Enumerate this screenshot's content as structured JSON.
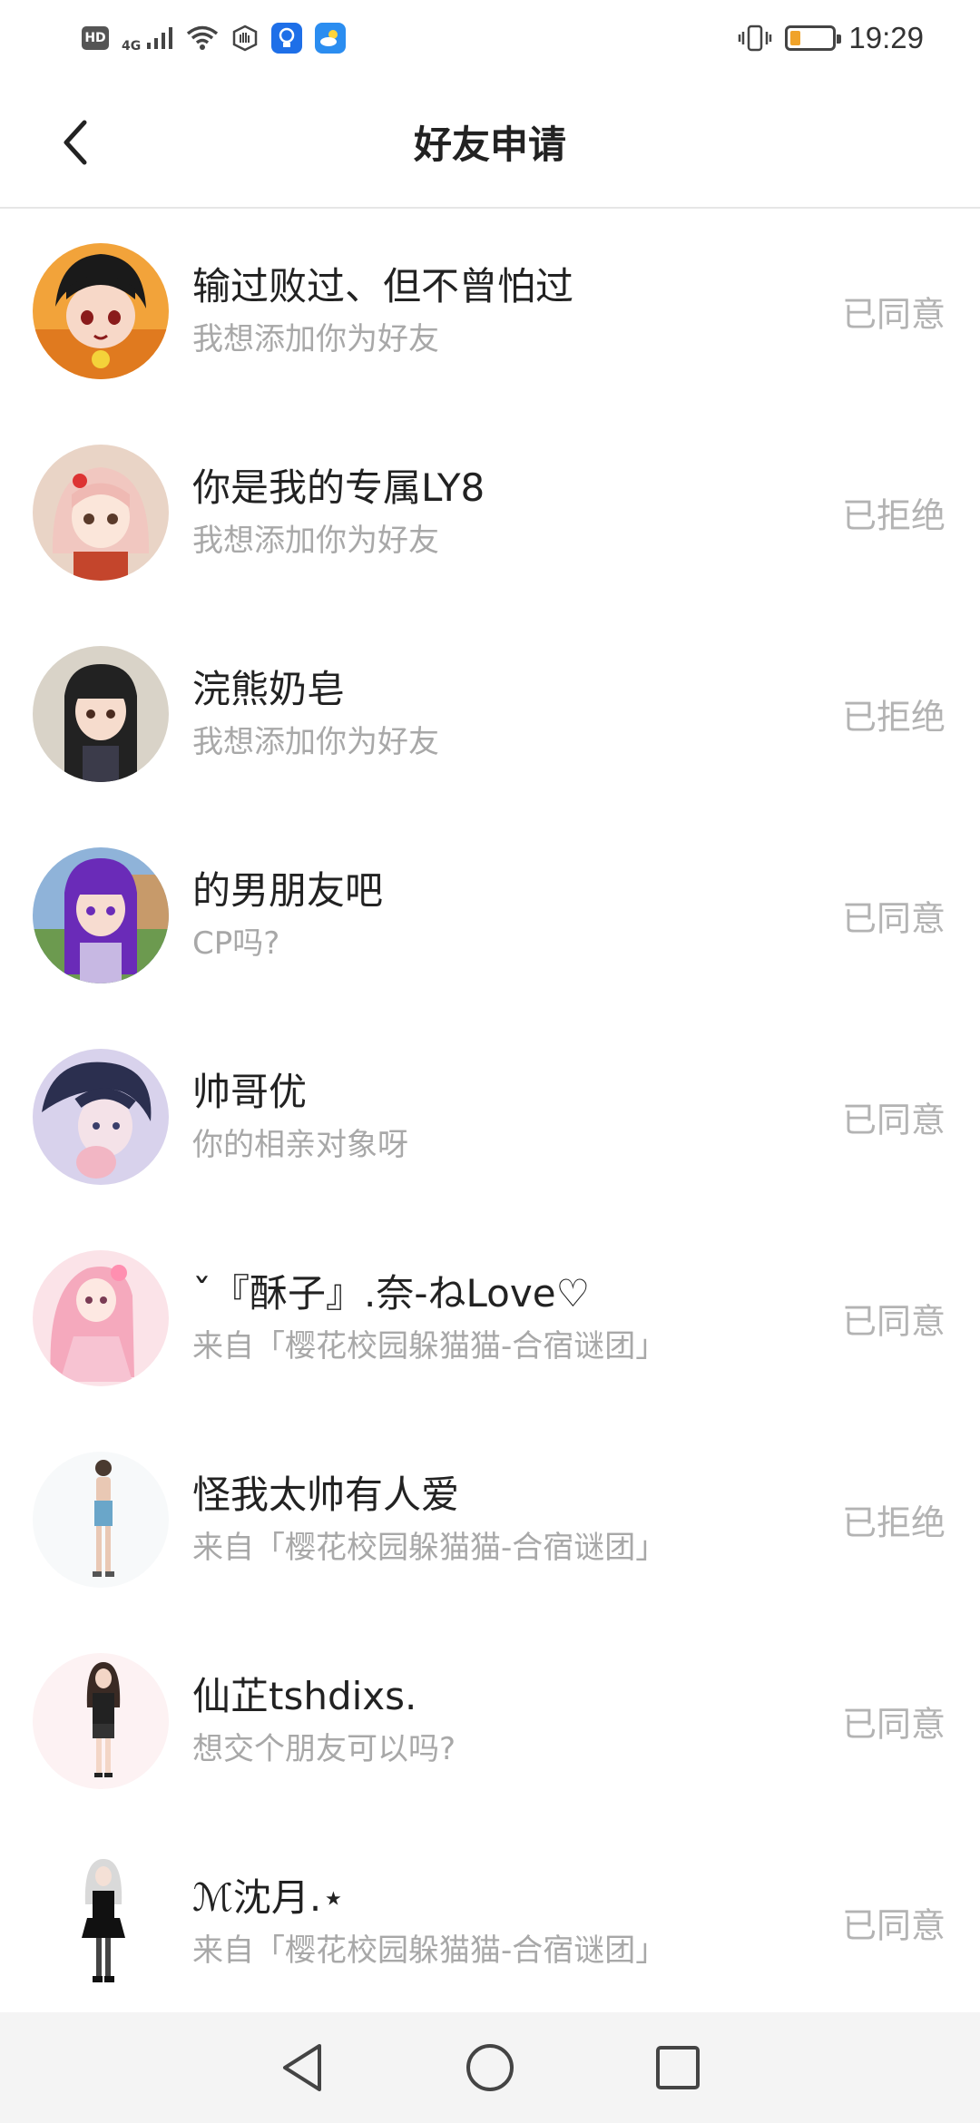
{
  "status_bar": {
    "hd": "HD",
    "network": "4G",
    "time": "19:29",
    "battery_level": 0.25,
    "battery_color": "#f0a32a"
  },
  "header": {
    "title": "好友申请",
    "back_icon": "chevron-left-icon"
  },
  "requests": [
    {
      "name": "输过败过、但不曾怕过",
      "message": "我想添加你为好友",
      "status": "已同意",
      "avatar_bg": "#f2a33a"
    },
    {
      "name": "你是我的专属LY8",
      "message": "我想添加你为好友",
      "status": "已拒绝",
      "avatar_bg": "#e9d4c6"
    },
    {
      "name": "浣熊奶皂",
      "message": "我想添加你为好友",
      "status": "已拒绝",
      "avatar_bg": "#d9d3c8"
    },
    {
      "name": "的男朋友吧",
      "message": "CP吗?",
      "status": "已同意",
      "avatar_bg": "#8fb3d9"
    },
    {
      "name": "帅哥优",
      "message": "你的相亲对象呀",
      "status": "已同意",
      "avatar_bg": "#d8d2ec"
    },
    {
      "name": "ˇ『酥子』.奈-ねLove♡",
      "message": "来自「樱花校园躲猫猫-合宿谜团」",
      "status": "已同意",
      "avatar_bg": "#fbe3e8"
    },
    {
      "name": "怪我太帅有人爱",
      "message": "来自「樱花校园躲猫猫-合宿谜团」",
      "status": "已拒绝",
      "avatar_bg": "#f7f9fa"
    },
    {
      "name": "仙芷tshdixs.",
      "message": "想交个朋友可以吗?",
      "status": "已同意",
      "avatar_bg": "#fdf2f3"
    },
    {
      "name": "ℳ沈月.⋆",
      "message": "来自「樱花校园躲猫猫-合宿谜团」",
      "status": "已同意",
      "avatar_bg": "#ffffff"
    }
  ],
  "nav_bar": {
    "back": "triangle-back-icon",
    "home": "circle-home-icon",
    "recents": "square-recents-icon"
  }
}
